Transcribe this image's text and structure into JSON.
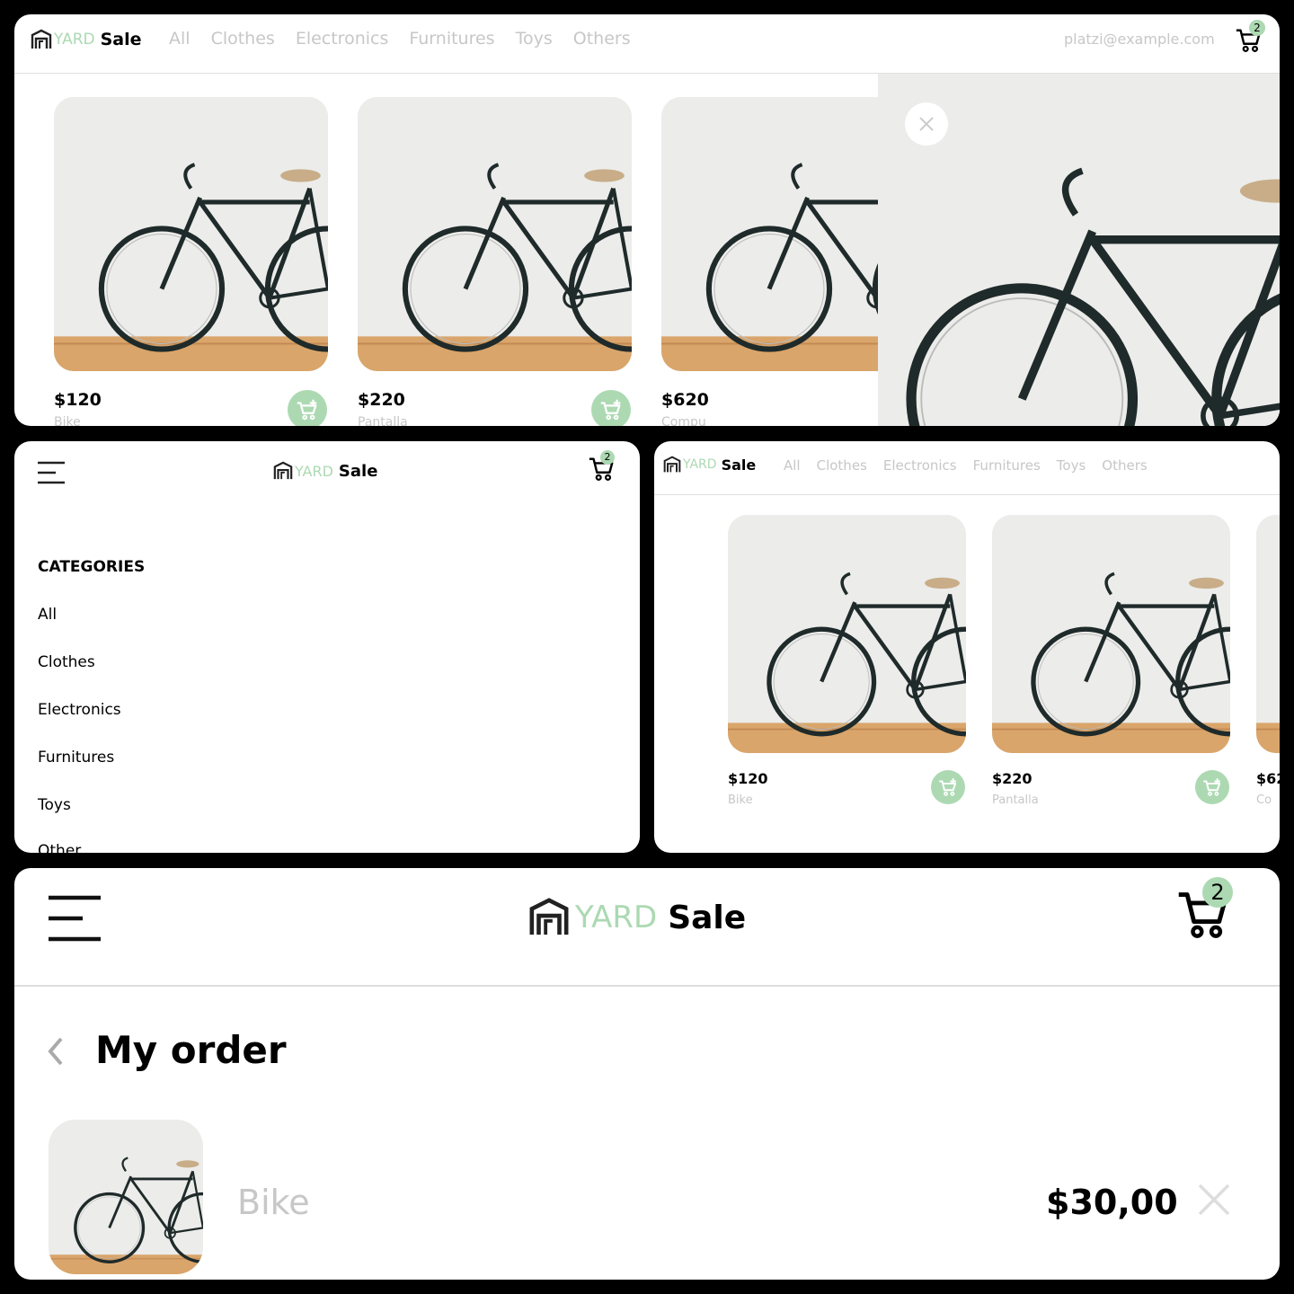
{
  "brand": {
    "yard": "YARD",
    "sale": "Sale"
  },
  "nav": {
    "links": [
      "All",
      "Clothes",
      "Electronics",
      "Furnitures",
      "Toys",
      "Others"
    ],
    "email": "platzi@example.com",
    "cart_count": "2"
  },
  "products_desktop": [
    {
      "price": "$120",
      "name": "Bike"
    },
    {
      "price": "$220",
      "name": "Pantalla"
    },
    {
      "price": "$620",
      "name": "Compu"
    }
  ],
  "products_tablet": [
    {
      "price": "$120",
      "name": "Bike"
    },
    {
      "price": "$220",
      "name": "Pantalla"
    },
    {
      "price": "$62",
      "name": "Co"
    }
  ],
  "mobile_menu": {
    "title": "CATEGORIES",
    "items": [
      "All",
      "Clothes",
      "Electronics",
      "Furnitures",
      "Toys",
      "Other"
    ]
  },
  "order": {
    "title": "My order",
    "item": {
      "name": "Bike",
      "price": "$30,00"
    }
  },
  "colors": {
    "accent": "#acd9b2",
    "muted": "#c7c7c7",
    "image_bg": "#ececea",
    "floor": "#d9a56b"
  },
  "icons": [
    "menu-icon",
    "cart-icon",
    "add-to-cart-icon",
    "close-icon",
    "chevron-left-icon",
    "house-logo-icon"
  ]
}
